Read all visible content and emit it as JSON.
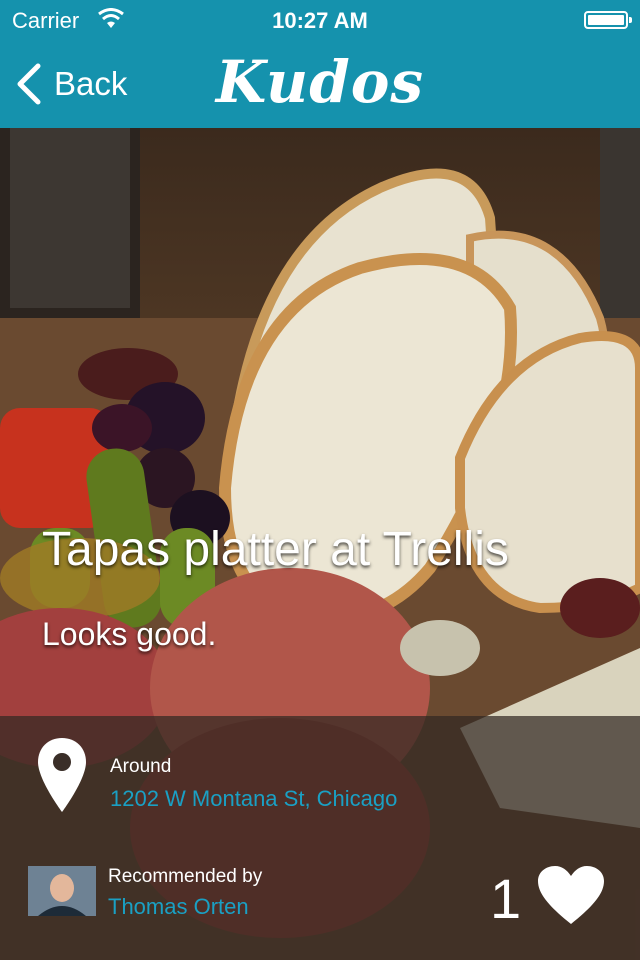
{
  "status_bar": {
    "carrier": "Carrier",
    "time": "10:27 AM"
  },
  "nav": {
    "back_label": "Back",
    "brand": "Kudos"
  },
  "post": {
    "title": "Tapas platter at Trellis",
    "caption": "Looks good.",
    "location_label": "Around",
    "address": "1202 W Montana St, Chicago",
    "recommended_label": "Recommended by",
    "recommender": "Thomas Orten",
    "like_count": "1"
  },
  "colors": {
    "accent": "#1592ad",
    "link": "#1aa0c4"
  },
  "icons": [
    "wifi-icon",
    "battery-icon",
    "chevron-left-icon",
    "location-pin-icon",
    "heart-icon"
  ]
}
